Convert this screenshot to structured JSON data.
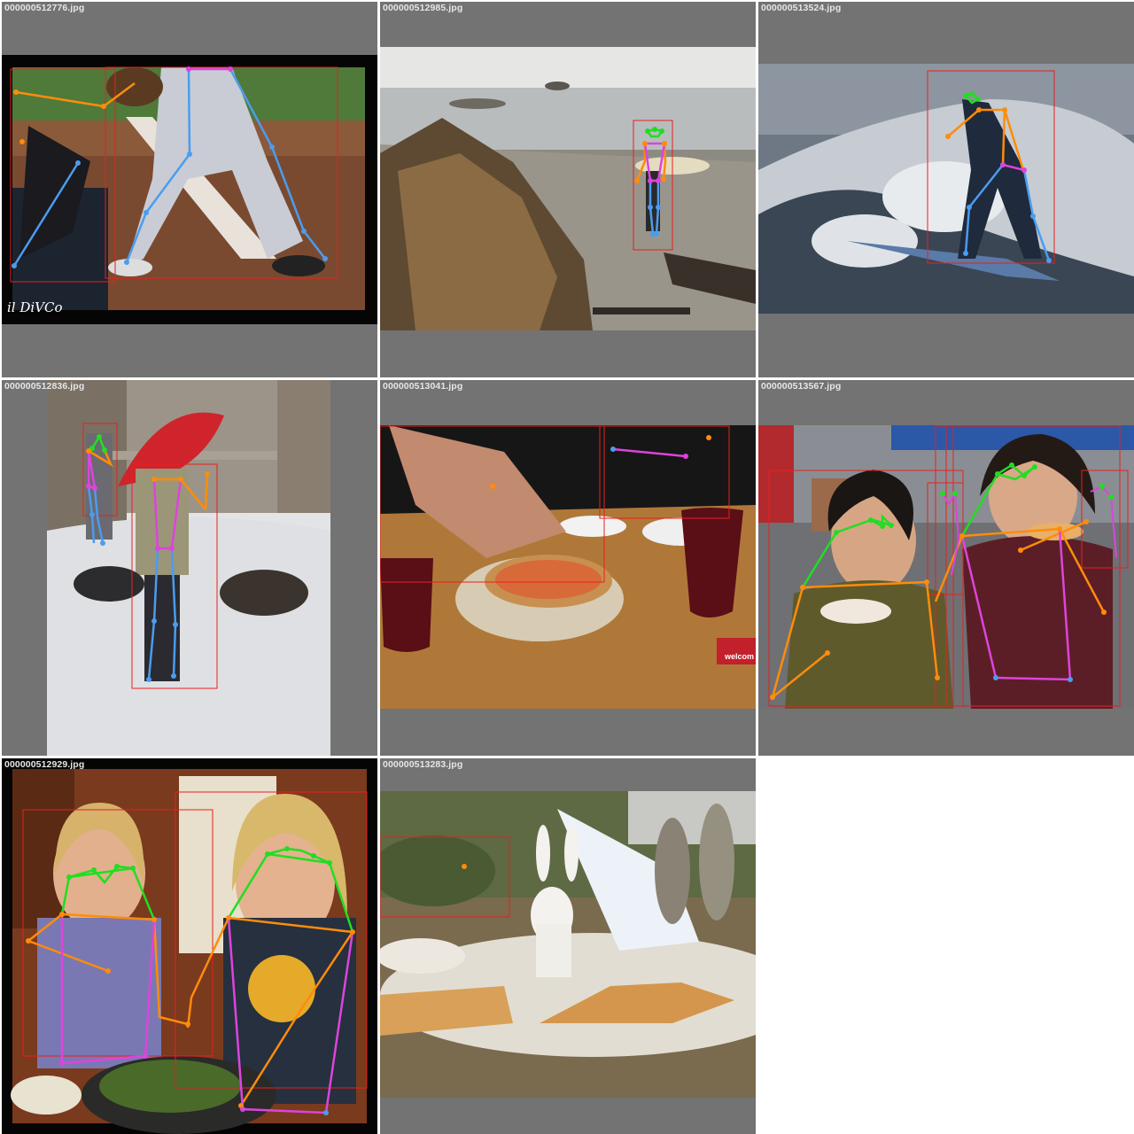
{
  "grid": {
    "tiles": [
      {
        "filename": "000000512776.jpg"
      },
      {
        "filename": "000000512985.jpg"
      },
      {
        "filename": "000000513524.jpg"
      },
      {
        "filename": "000000512836.jpg"
      },
      {
        "filename": "000000513041.jpg"
      },
      {
        "filename": "000000513567.jpg"
      },
      {
        "filename": "000000512929.jpg"
      },
      {
        "filename": "000000513283.jpg"
      }
    ]
  },
  "image_text": {
    "watermark": "il DiVCo",
    "sign": "welcom"
  },
  "colors": {
    "tile_background": "#737373",
    "bbox": "#e8201e",
    "skeleton_face": "#22dd22",
    "skeleton_arm": "#ff8c0a",
    "skeleton_leg": "#4a9cf0",
    "skeleton_torso": "#dd44dd"
  }
}
